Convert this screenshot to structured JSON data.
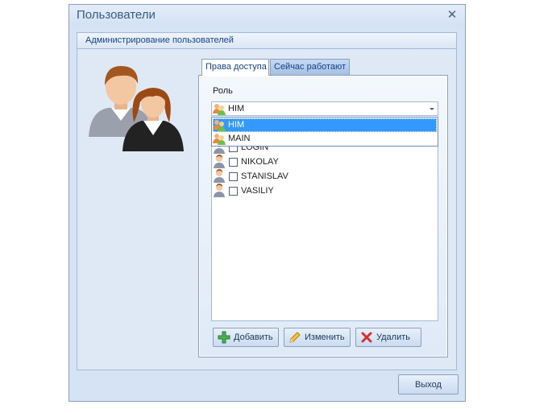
{
  "window": {
    "title": "Пользователи",
    "close_glyph": "✕"
  },
  "group": {
    "title": "Администрирование пользователей",
    "illustration_icon": "users-illustration-icon"
  },
  "tabs": [
    {
      "label": "Права доступа",
      "active": true
    },
    {
      "label": "Сейчас работают",
      "active": false
    }
  ],
  "role": {
    "label": "Роль",
    "selected": "HIM",
    "options": [
      "HIM",
      "MAIN"
    ]
  },
  "users": [
    {
      "name": "LOGIN",
      "checked": false
    },
    {
      "name": "NIKOLAY",
      "checked": false
    },
    {
      "name": "STANISLAV",
      "checked": false
    },
    {
      "name": "VASILIY",
      "checked": false
    }
  ],
  "buttons": {
    "add": "Добавить",
    "edit": "Изменить",
    "delete": "Удалить",
    "exit": "Выход"
  },
  "colors": {
    "accent": "#15428b",
    "selection": "#3399ff"
  }
}
